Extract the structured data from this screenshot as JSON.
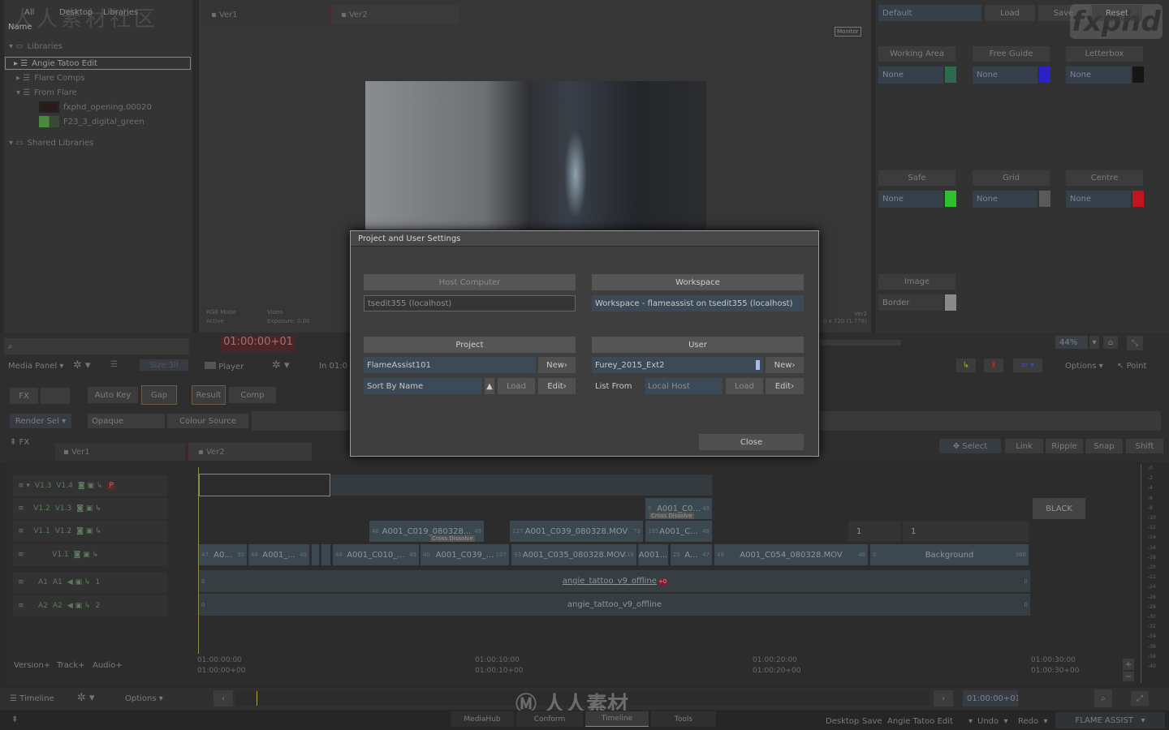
{
  "media_panel": {
    "tabs": [
      "All",
      "Desktop",
      "Libraries"
    ],
    "column_name": "Name",
    "tree": [
      {
        "label": "Libraries",
        "state": "expanded"
      },
      {
        "label": "Angie Tatoo Edit",
        "state": "collapsed",
        "selected": true
      },
      {
        "label": "Flare Comps",
        "state": "collapsed"
      },
      {
        "label": "From Flare",
        "state": "expanded"
      },
      {
        "label": "fxphd_opening.00020",
        "type": "clip"
      },
      {
        "label": "F23_3_digital_green",
        "type": "clip"
      },
      {
        "label": "Shared Libraries",
        "state": "expanded"
      }
    ],
    "search_placeholder": "",
    "footer": {
      "label": "Media Panel",
      "size": "Size 3ll"
    }
  },
  "viewer": {
    "tabs": [
      "Ver1",
      "Ver2"
    ],
    "monitor_label": "Monitor",
    "info_left": [
      "RGB Mode",
      "Active"
    ],
    "info_mid": [
      "Video",
      "Exposure: 0.00"
    ],
    "info_right": [
      "Ver2",
      "0 x 720 (1.778)"
    ],
    "timecode": "01:00:00+01",
    "player_label": "Player",
    "in_label": "In",
    "in_value": "01:0"
  },
  "right_panel": {
    "preset": "Default",
    "buttons": [
      "Load",
      "Save",
      "Reset"
    ],
    "guides": [
      {
        "label": "Working Area",
        "value": "None",
        "color": "#2e6a50"
      },
      {
        "label": "Free Guide",
        "value": "None",
        "color": "#2a22c8"
      },
      {
        "label": "Letterbox",
        "value": "None",
        "color": "#151515"
      },
      {
        "label": "Safe",
        "value": "None",
        "color": "#2fc02f"
      },
      {
        "label": "Grid",
        "value": "None",
        "color": "#5a5a5a"
      },
      {
        "label": "Centre",
        "value": "None",
        "color": "#c0141e"
      }
    ],
    "image": {
      "label": "Image",
      "value": "Border",
      "color": "#8a8a8a"
    },
    "zoom": "44%",
    "options": "Options",
    "point": "Point"
  },
  "brand_logo": "fxphd",
  "fx_row": {
    "fx": "FX",
    "auto_key": "Auto Key",
    "gap": "Gap",
    "result": "Result",
    "comp": "Comp",
    "render_sel": "Render Sel",
    "opaque": "Opaque",
    "colour_source": "Colour Source",
    "fx_toggle": "FX"
  },
  "edit_modes": [
    "Select",
    "Link",
    "Ripple",
    "Snap",
    "Shift"
  ],
  "timeline": {
    "tabs": [
      "Ver1",
      "Ver2"
    ],
    "tracks": [
      {
        "a": "V1.3",
        "b": "V1.4",
        "p": "P"
      },
      {
        "a": "V1.2",
        "b": "V1.3"
      },
      {
        "a": "V1.1",
        "b": "V1.2"
      },
      {
        "a": "",
        "b": "V1.1"
      },
      {
        "a": "A1",
        "b": "A1",
        "n": "1"
      },
      {
        "a": "A2",
        "b": "A2",
        "n": "2"
      }
    ],
    "clips": {
      "v13": {
        "name": "A001_C0...",
        "in": "0",
        "out": "49",
        "transition": "Cross Dissolve"
      },
      "black": "BLACK",
      "v12": [
        {
          "name": "A001_C019_080328...",
          "in": "48",
          "out": "49",
          "transition": "Cross Dissolve"
        },
        {
          "name": "A001_C039_080328.MOV",
          "in": "127",
          "out": "73"
        },
        {
          "name": "A001_C...",
          "in": "195",
          "out": "48"
        },
        {
          "name": "1"
        },
        {
          "name": "1"
        }
      ],
      "v11": [
        {
          "name": "A0...",
          "in": "47",
          "out": "30"
        },
        {
          "name": "A001_...",
          "in": "48",
          "out": "40"
        },
        {
          "name": "A001_C010_...",
          "in": "48",
          "out": "49"
        },
        {
          "name": "A001_C039_...",
          "in": "40",
          "out": "107"
        },
        {
          "name": "A001_C035_080328.MOV",
          "in": "93",
          "out": "118"
        },
        {
          "name": "A001...",
          "in": "",
          "out": ""
        },
        {
          "name": "A...",
          "in": "25",
          "out": "47"
        },
        {
          "name": "A001_C054_080328.MOV",
          "in": "48",
          "out": "48"
        },
        {
          "name": "Background",
          "in": "0",
          "out": "360"
        }
      ],
      "a1": {
        "name": "angie_tattoo_v9_offline",
        "in": "0",
        "out": "0",
        "badge": "+0"
      },
      "a2": {
        "name": "angie_tattoo_v9_offline",
        "in": "0",
        "out": "0"
      }
    },
    "ruler": [
      [
        "01:00:00:00",
        "01:00:00+00"
      ],
      [
        "01:00:10:00",
        "01:00:10+00"
      ],
      [
        "01:00:20:00",
        "01:00:20+00"
      ],
      [
        "01:00:30:00",
        "01:00:30+00"
      ]
    ],
    "footer_buttons": [
      "Version+",
      "Track+",
      "Audio+"
    ],
    "meter": [
      "0",
      "2",
      "4",
      "6",
      "8",
      "10",
      "12",
      "14",
      "16",
      "18",
      "20",
      "22",
      "24",
      "26",
      "28",
      "30",
      "32",
      "34",
      "36",
      "38",
      "40"
    ],
    "bottom": {
      "label": "Timeline",
      "options": "Options",
      "timecode": "01:00:00+01"
    }
  },
  "tabs_bottom": [
    "MediaHub",
    "Conform",
    "Timeline",
    "Tools"
  ],
  "status_bar": {
    "desktop": "Desktop",
    "save": "Save",
    "library": "Angie Tatoo Edit",
    "undo": "Undo",
    "redo": "Redo",
    "app": "FLAME ASSIST"
  },
  "watermark": "人人素材",
  "dialog": {
    "title": "Project and User Settings",
    "host_header": "Host Computer",
    "host_value": "tsedit355 (localhost)",
    "workspace_header": "Workspace",
    "workspace_value": "Workspace - flameassist on tsedit355 (localhost)",
    "project_header": "Project",
    "project_value": "FlameAssist101",
    "project_new": "New",
    "sort": "Sort By Name",
    "project_load": "Load",
    "project_edit": "Edit",
    "user_header": "User",
    "user_value": "Furey_2015_Ext2",
    "user_new": "New",
    "list_from": "List From",
    "list_from_value": "Local Host",
    "user_load": "Load",
    "user_edit": "Edit",
    "close": "Close"
  }
}
